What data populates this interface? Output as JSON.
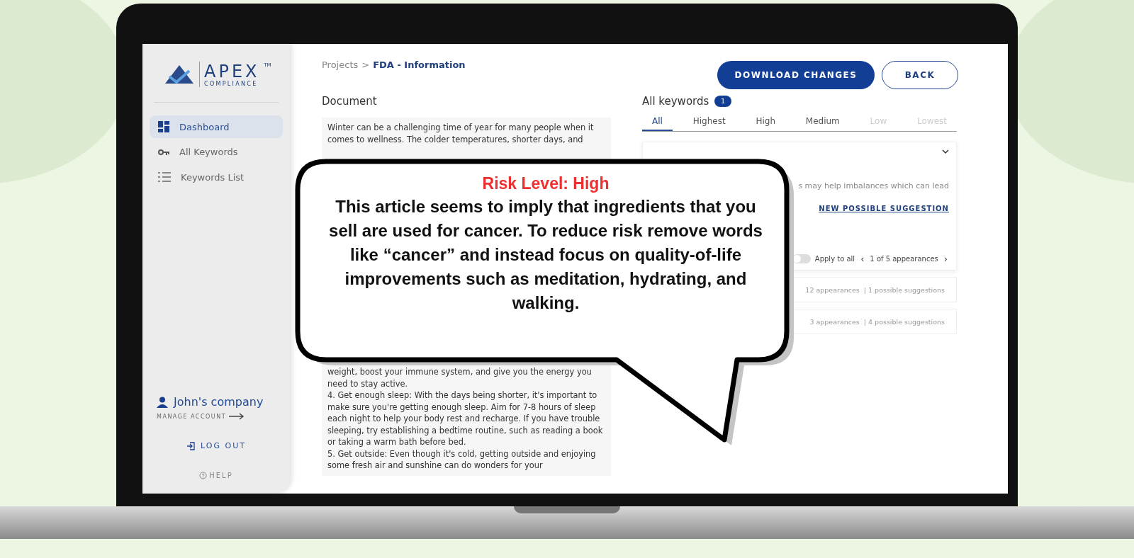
{
  "sidebar": {
    "logo": {
      "name": "APEX",
      "trademark": "TM",
      "subtitle": "COMPLIANCE"
    },
    "items": [
      {
        "label": "Dashboard",
        "kind": "dashboard",
        "selected": true
      },
      {
        "label": "All Keywords",
        "kind": "key",
        "selected": false
      },
      {
        "label": "Keywords List",
        "kind": "list",
        "selected": false
      }
    ],
    "account": {
      "name": "John's company",
      "manage": "MANAGE ACCOUNT"
    },
    "logout": "LOG OUT",
    "help": "HELP"
  },
  "breadcrumb": {
    "parent": "Projects",
    "separator": ">",
    "current": "FDA - Information"
  },
  "buttons": [
    {
      "label": "DOWNLOAD CHANGES",
      "kind": "primary"
    },
    {
      "label": "BACK",
      "kind": "outline"
    }
  ],
  "document": {
    "title": "Document",
    "text_top": "Winter can be a challenging time of year for many people when it comes to wellness. The colder temperatures, shorter days, and",
    "text_bottom": [
      "weight, boost your immune system, and give you the energy you need to stay active.",
      "4. Get enough sleep: With the days being shorter, it's important to make sure you're getting enough sleep. Aim for 7-8 hours of sleep each night to help your body rest and recharge. If you have trouble sleeping, try establishing a bedtime routine, such as reading a book or taking a warm bath before bed.",
      "5. Get outside: Even though it's cold, getting outside and enjoying some fresh air and sunshine can do wonders for your"
    ]
  },
  "keywords": {
    "title": "All keywords",
    "count": "1",
    "tabs": [
      {
        "label": "All",
        "selected": true,
        "disabled": false
      },
      {
        "label": "Highest",
        "selected": false,
        "disabled": false
      },
      {
        "label": "High",
        "selected": false,
        "disabled": false
      },
      {
        "label": "Medium",
        "selected": false,
        "disabled": false
      },
      {
        "label": "Low",
        "selected": false,
        "disabled": true
      },
      {
        "label": "Lowest",
        "selected": false,
        "disabled": true
      }
    ],
    "card": {
      "expanded": true,
      "text": "s may help imbalances which can lead",
      "suggestion_link": "NEW POSSIBLE SUGGESTION",
      "apply_all": {
        "label": "Apply to all",
        "on": false
      },
      "prev": "‹",
      "pager": "1 of 5 appearances",
      "next": "›"
    },
    "rows": [
      {
        "summary": "12 appearances  | 1 possible suggestions"
      },
      {
        "summary": "3 appearances  | 4 possible suggestions"
      }
    ]
  },
  "callout": {
    "heading": "Risk Level: High",
    "body": "This article seems to imply that ingredients that you sell are used for cancer. To reduce risk remove words like “cancer” and instead focus on quality-of-life improvements such as meditation, hydrating,  and walking."
  }
}
